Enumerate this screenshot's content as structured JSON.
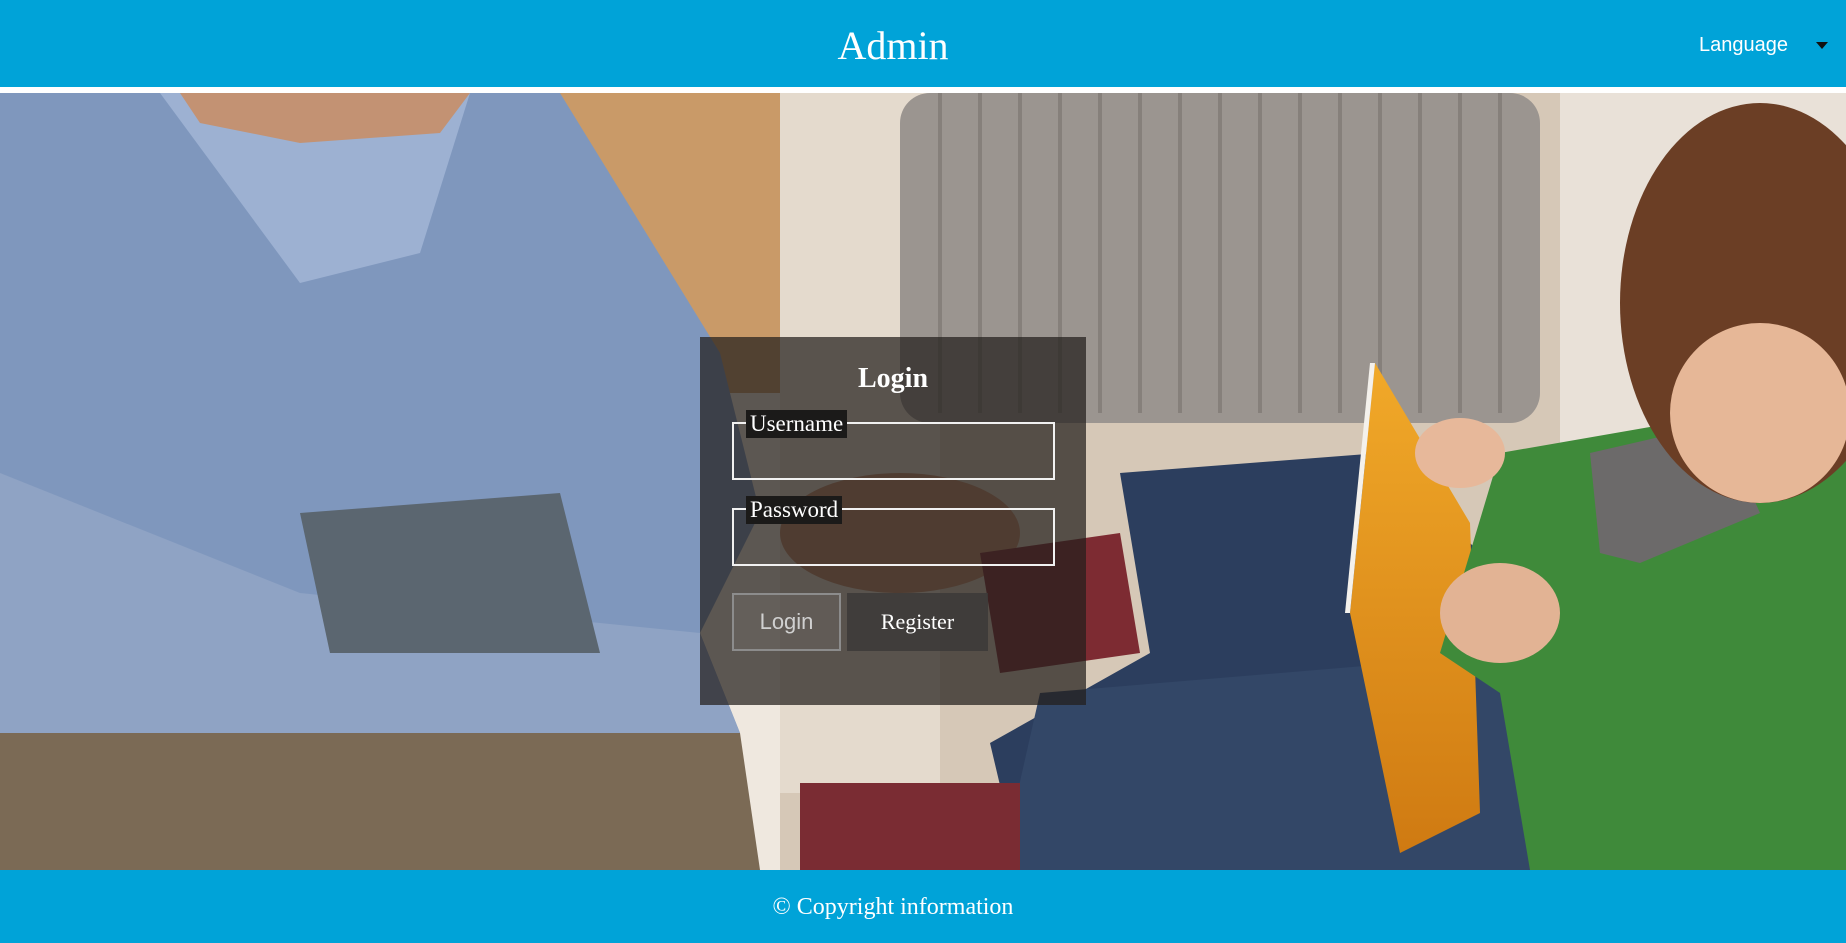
{
  "header": {
    "title": "Admin",
    "language_label": "Language"
  },
  "login": {
    "title": "Login",
    "username_label": "Username",
    "username_value": "",
    "password_label": "Password",
    "password_value": "",
    "login_button": "Login",
    "register_button": "Register"
  },
  "footer": {
    "copyright": "© Copyright information"
  },
  "colors": {
    "header_bg": "#00a3d8",
    "footer_bg": "#00a3d8",
    "panel_bg": "rgba(35,30,28,0.72)"
  }
}
